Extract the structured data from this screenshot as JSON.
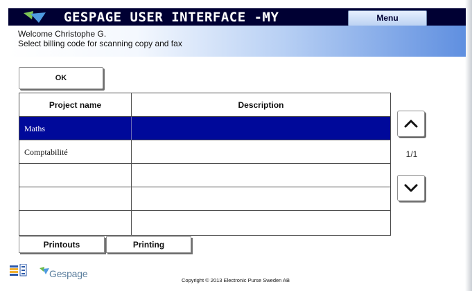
{
  "header": {
    "title": "GESPAGE USER INTERFACE -MY",
    "menu_label": "Menu",
    "welcome": "Welcome Christophe G.",
    "instruction": "Select billing code for scanning copy and fax"
  },
  "actions": {
    "ok_label": "OK"
  },
  "table": {
    "columns": [
      "Project name",
      "Description"
    ],
    "rows": [
      {
        "project": "Maths",
        "description": "",
        "selected": true
      },
      {
        "project": "Comptabilité",
        "description": "",
        "selected": false
      },
      {
        "project": "",
        "description": "",
        "selected": false
      },
      {
        "project": "",
        "description": "",
        "selected": false
      },
      {
        "project": "",
        "description": "",
        "selected": false
      }
    ]
  },
  "pager": {
    "indicator": "1/1",
    "up_icon": "chevron-up-icon",
    "down_icon": "chevron-down-icon"
  },
  "tabs": [
    {
      "label": "Printouts"
    },
    {
      "label": "Printing"
    }
  ],
  "footer": {
    "brand": "Gespage",
    "copyright": "Copyright © 2013 Electronic Purse Sweden AB"
  },
  "colors": {
    "title_bar": "#000033",
    "selected_row": "#00099a",
    "brand_blue": "#5b7e9d",
    "brand_green": "#6dbb4a"
  }
}
